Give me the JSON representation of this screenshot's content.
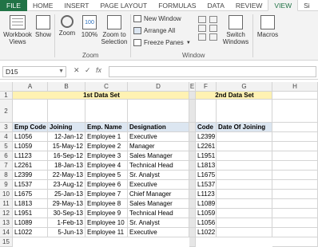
{
  "tabs": [
    "FILE",
    "HOME",
    "INSERT",
    "PAGE LAYOUT",
    "FORMULAS",
    "DATA",
    "REVIEW",
    "VIEW",
    "Si"
  ],
  "active_tab": "VIEW",
  "ribbon": {
    "workbook_views": "Workbook\nViews",
    "show": "Show",
    "zoom": "Zoom",
    "zoom100": "100%",
    "zoom_to_selection": "Zoom to\nSelection",
    "zoom_group": "Zoom",
    "new_window": "New Window",
    "arrange_all": "Arrange All",
    "freeze_panes": "Freeze Panes",
    "switch_windows": "Switch\nWindows",
    "window_group": "Window",
    "macros": "Macros"
  },
  "formula_bar": {
    "name_box": "D15",
    "fx": "fx",
    "value": ""
  },
  "columns": [
    "A",
    "B",
    "C",
    "D",
    "E",
    "F",
    "G",
    "H"
  ],
  "rows": [
    "1",
    "2",
    "3",
    "4",
    "5",
    "6",
    "7",
    "8",
    "9",
    "10",
    "11",
    "12",
    "13",
    "14",
    "15"
  ],
  "table1": {
    "title": "1st Data Set",
    "headers": [
      "Emp Code",
      "Date Of Joining",
      "Emp. Name",
      "Designation"
    ],
    "data": [
      [
        "L1056",
        "12-Jan-12",
        "Employee 1",
        "Executive"
      ],
      [
        "L1059",
        "15-May-12",
        "Employee 2",
        "Manager"
      ],
      [
        "L1123",
        "16-Sep-12",
        "Employee 3",
        "Sales Manager"
      ],
      [
        "L2261",
        "18-Jan-13",
        "Employee 4",
        "Technical Head"
      ],
      [
        "L2399",
        "22-May-13",
        "Employee 5",
        "Sr. Analyst"
      ],
      [
        "L1537",
        "23-Aug-12",
        "Employee 6",
        "Executive"
      ],
      [
        "L1675",
        "25-Jan-13",
        "Employee 7",
        "Chief Manager"
      ],
      [
        "L1813",
        "29-May-13",
        "Employee 8",
        "Sales Manager"
      ],
      [
        "L1951",
        "30-Sep-13",
        "Employee 9",
        "Technical Head"
      ],
      [
        "L1089",
        "1-Feb-13",
        "Employee 10",
        "Sr. Analyst"
      ],
      [
        "L1022",
        "5-Jun-13",
        "Employee 11",
        "Executive"
      ]
    ]
  },
  "table2": {
    "title": "2nd Data Set",
    "headers": [
      "Emp Code",
      "Date Of Joining"
    ],
    "codes": [
      "L2399",
      "L2261",
      "L1951",
      "L1813",
      "L1675",
      "L1537",
      "L1123",
      "L1089",
      "L1059",
      "L1056",
      "L1022"
    ]
  }
}
